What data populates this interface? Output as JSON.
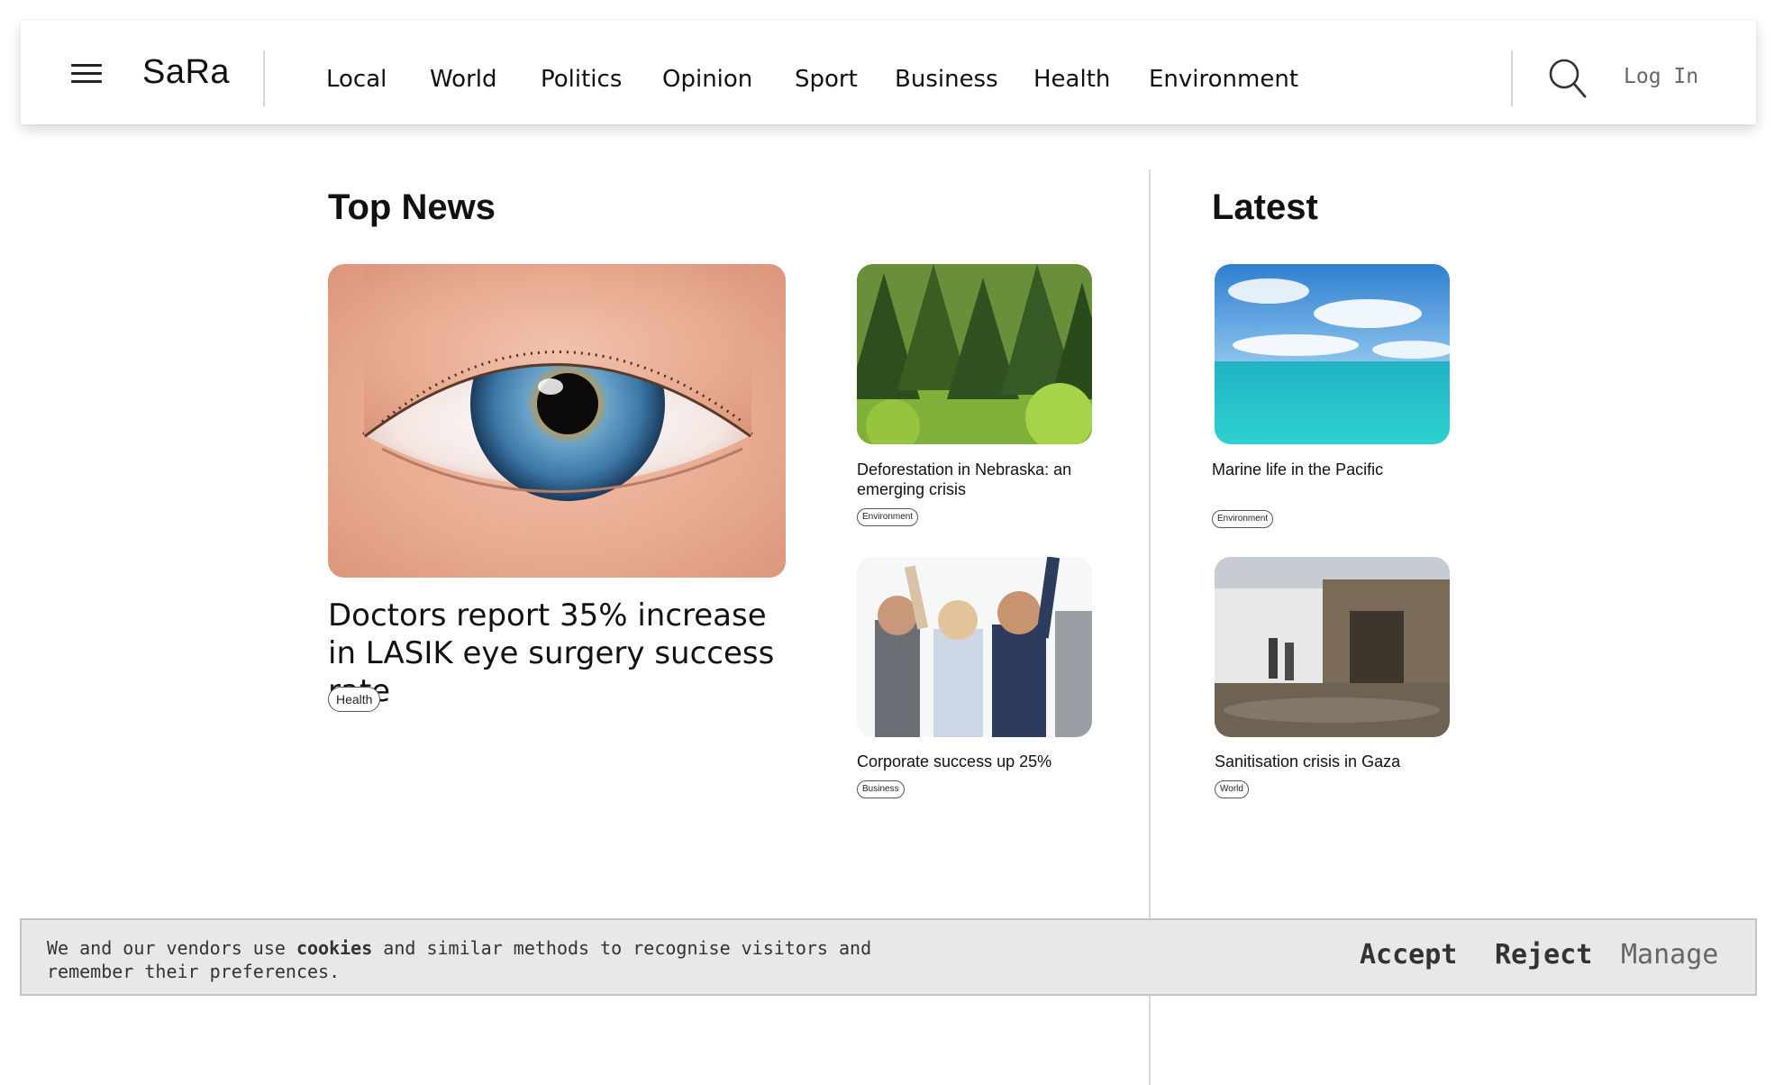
{
  "header": {
    "logo": "SaRa",
    "nav": [
      "Local",
      "World",
      "Politics",
      "Opinion",
      "Sport",
      "Business",
      "Health",
      "Environment"
    ],
    "login_label": "Log In"
  },
  "top_news": {
    "title": "Top News",
    "featured": {
      "headline": "Doctors report 35% increase in LASIK eye surgery success rate",
      "tag": "Health",
      "image": "blue-eye-closeup"
    },
    "secondary": [
      {
        "headline": "Deforestation in Nebraska: an emerging crisis",
        "tag": "Environment",
        "image": "pine-forest"
      },
      {
        "headline": "Corporate success up 25%",
        "tag": "Business",
        "image": "celebrating-colleagues"
      }
    ]
  },
  "latest": {
    "title": "Latest",
    "items": [
      {
        "headline": "Marine life in the Pacific",
        "tag": "Environment",
        "image": "turquoise-ocean"
      },
      {
        "headline": "Sanitisation crisis in Gaza",
        "tag": "World",
        "image": "flooded-tent-camp"
      }
    ]
  },
  "cookie_banner": {
    "text_before": "We and our vendors use ",
    "text_bold": "cookies",
    "text_after": " and similar methods to recognise visitors and remember their preferences.",
    "accept_label": "Accept",
    "reject_label": "Reject",
    "manage_label": "Manage"
  },
  "colors": {
    "text": "#111111",
    "muted": "#666666",
    "banner_bg": "#e8e8e8",
    "divider": "#d9d9d9"
  }
}
